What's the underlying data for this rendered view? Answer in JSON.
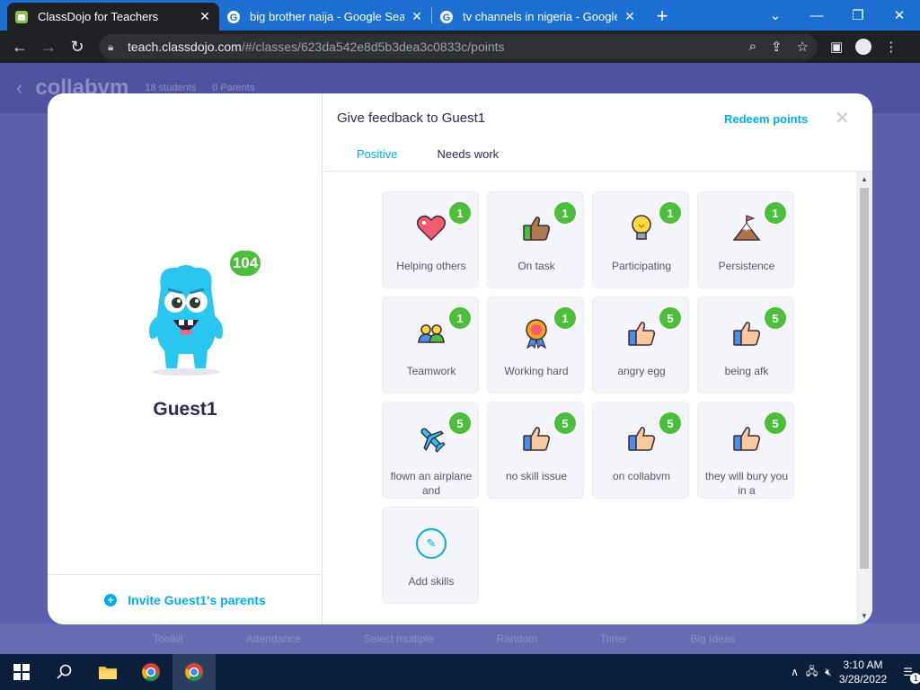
{
  "browser": {
    "tabs": [
      {
        "title": "ClassDojo for Teachers",
        "active": true
      },
      {
        "title": "big brother naija - Google Search",
        "active": false
      },
      {
        "title": "tv channels in nigeria - Google Search",
        "active": false
      }
    ],
    "url_domain": "teach.classdojo.com",
    "url_path": "/#/classes/623da542e8d5b3dea3c0833c/points"
  },
  "page": {
    "class_name": "collabvm",
    "students_count": "18 students",
    "parents_count": "0 Parents",
    "footer_items": [
      "Toolkit",
      "Attendance",
      "Select multiple",
      "Random",
      "Timer",
      "Big Ideas"
    ]
  },
  "student": {
    "name": "Guest1",
    "points": "104",
    "invite_label": "Invite Guest1's parents"
  },
  "feedback": {
    "title": "Give feedback to Guest1",
    "redeem_label": "Redeem points",
    "tabs": [
      "Positive",
      "Needs work"
    ],
    "skills": [
      {
        "label": "Helping others",
        "points": "1",
        "icon": "heart-icon"
      },
      {
        "label": "On task",
        "points": "1",
        "icon": "thumbs-up-icon"
      },
      {
        "label": "Participating",
        "points": "1",
        "icon": "lightbulb-icon"
      },
      {
        "label": "Persistence",
        "points": "1",
        "icon": "mountain-flag-icon"
      },
      {
        "label": "Teamwork",
        "points": "1",
        "icon": "team-icon"
      },
      {
        "label": "Working hard",
        "points": "1",
        "icon": "medal-icon"
      },
      {
        "label": "angry egg",
        "points": "5",
        "icon": "thumbs-up-icon"
      },
      {
        "label": "being afk",
        "points": "5",
        "icon": "thumbs-up-icon"
      },
      {
        "label": "flown an airplane and",
        "points": "5",
        "icon": "airplane-icon"
      },
      {
        "label": "no skill issue",
        "points": "5",
        "icon": "thumbs-up-icon"
      },
      {
        "label": "on collabvm",
        "points": "5",
        "icon": "thumbs-up-icon"
      },
      {
        "label": "they will bury you in a",
        "points": "5",
        "icon": "thumbs-up-icon"
      }
    ],
    "add_skills_label": "Add skills"
  },
  "taskbar": {
    "time": "3:10 AM",
    "date": "3/28/2022",
    "notification_count": "1"
  },
  "colors": {
    "accent": "#00aeef",
    "badge_green": "#4bbf3b",
    "monster": "#29c6f0",
    "tabbar_blue": "#1a6fd1"
  }
}
